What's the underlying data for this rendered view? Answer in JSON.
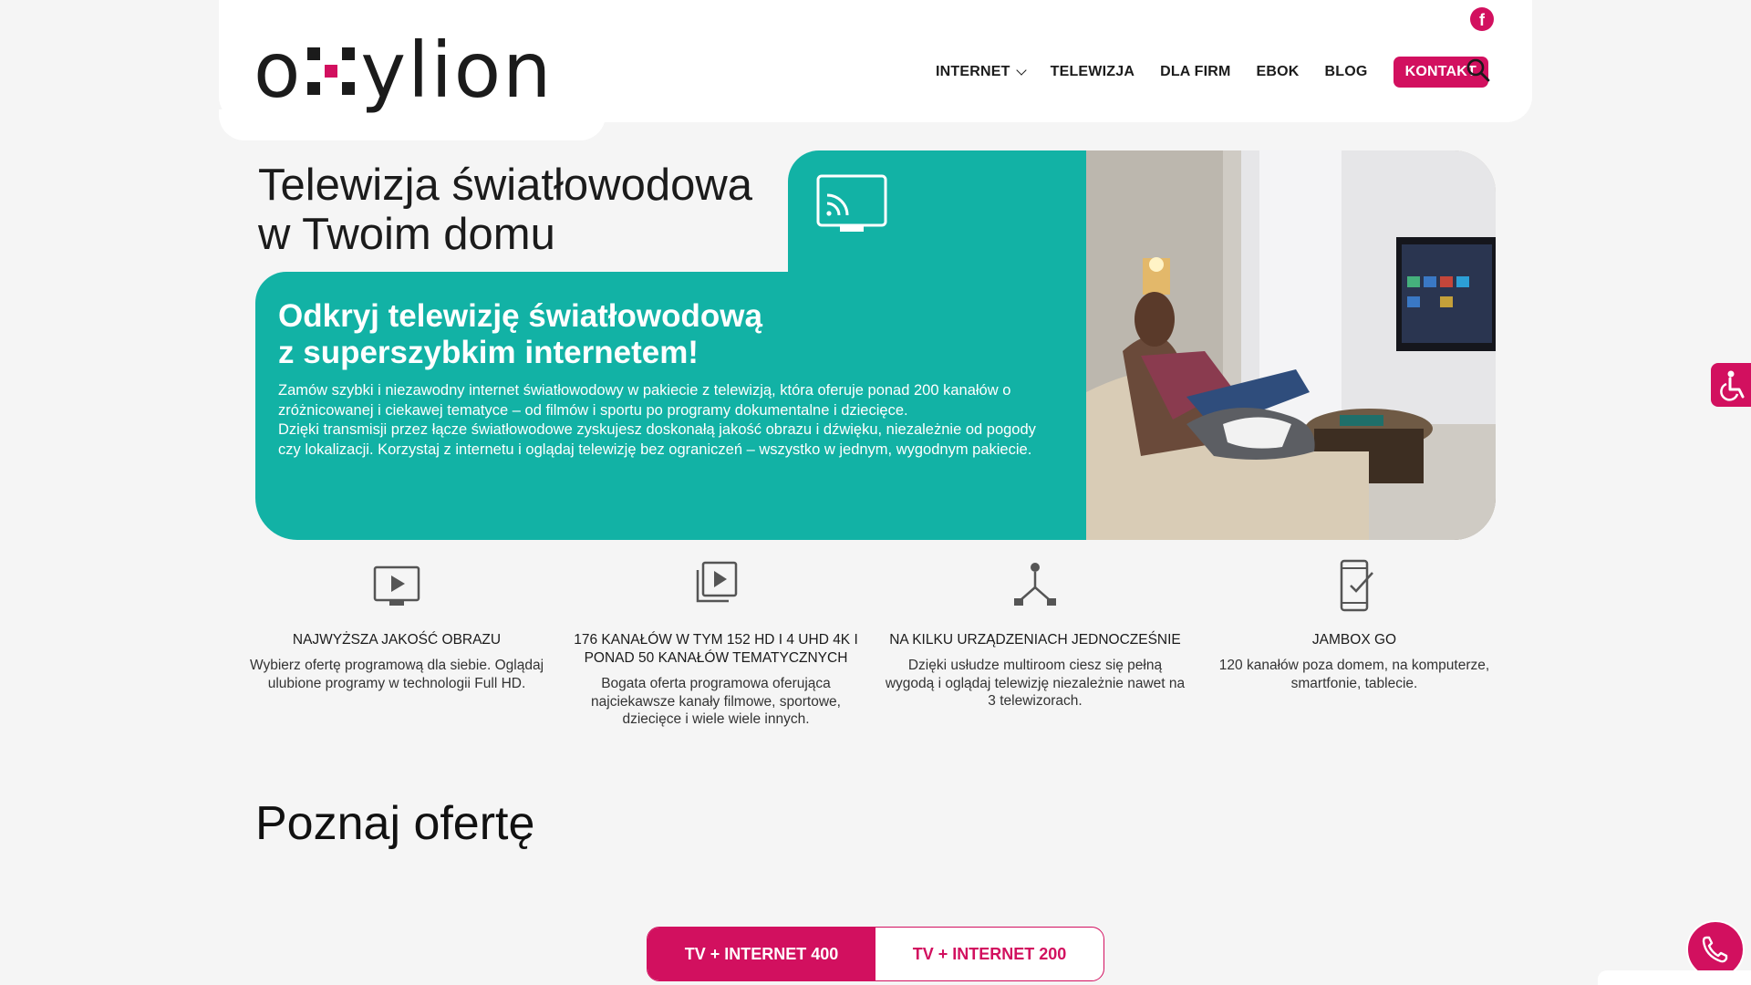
{
  "brand": {
    "logo_text_left": "o",
    "logo_text_right": "ylion",
    "accent": "#d2105f",
    "teal": "#12b2a5"
  },
  "header": {
    "social": "facebook-icon",
    "nav": [
      {
        "label": "INTERNET",
        "has_dropdown": true
      },
      {
        "label": "TELEWIZJA"
      },
      {
        "label": "DLA FIRM"
      },
      {
        "label": "EBOK"
      },
      {
        "label": "BLOG"
      }
    ],
    "contact_label": "KONTAKT"
  },
  "hero": {
    "title_line1": "Telewizja światłowodowa",
    "title_line2": "w Twoim domu",
    "subtitle_line1": "Odkryj telewizję światłowodową",
    "subtitle_line2": "z superszybkim internetem!",
    "text_p1": "Zamów szybki i niezawodny internet światłowodowy w pakiecie z telewizją, która oferuje ponad 200 kanałów o zróżnicowanej i ciekawej tematyce – od filmów i sportu po programy dokumentalne i dziecięce.",
    "text_p2": "Dzięki transmisji przez łącze światłowodowe zyskujesz doskonałą jakość obrazu i dźwięku, niezależnie od pogody czy lokalizacji. Korzystaj z internetu i oglądaj telewizję bez ograniczeń – wszystko w jednym, wygodnym pakiecie."
  },
  "features": [
    {
      "icon": "play-screen-icon",
      "title": "NAJWYŻSZA JAKOŚĆ OBRAZU",
      "text": "Wybierz ofertę programową dla siebie. Oglądaj ulubione programy w technologii Full HD."
    },
    {
      "icon": "channels-icon",
      "title": "176 KANAŁÓW W TYM 152 HD I 4 UHD 4K I PONAD 50 KANAŁÓW TEMATYCZNYCH",
      "text": "Bogata oferta programowa oferująca najciekawsze kanały filmowe, sportowe, dziecięce i wiele wiele innych."
    },
    {
      "icon": "multiroom-icon",
      "title": "NA KILKU URZĄDZENIACH JEDNOCZEŚNIE",
      "text": "Dzięki usłudze multiroom ciesz się pełną wygodą i oglądaj telewizję niezależnie nawet na 3 telewizorach."
    },
    {
      "icon": "mobile-check-icon",
      "title": "JAMBOX GO",
      "text": "120 kanałów poza domem, na komputerze, smartfonie, tablecie."
    }
  ],
  "offer": {
    "title": "Poznaj ofertę",
    "tabs": [
      {
        "label": "TV + INTERNET 400",
        "active": true
      },
      {
        "label": "TV + INTERNET 200",
        "active": false
      }
    ]
  }
}
